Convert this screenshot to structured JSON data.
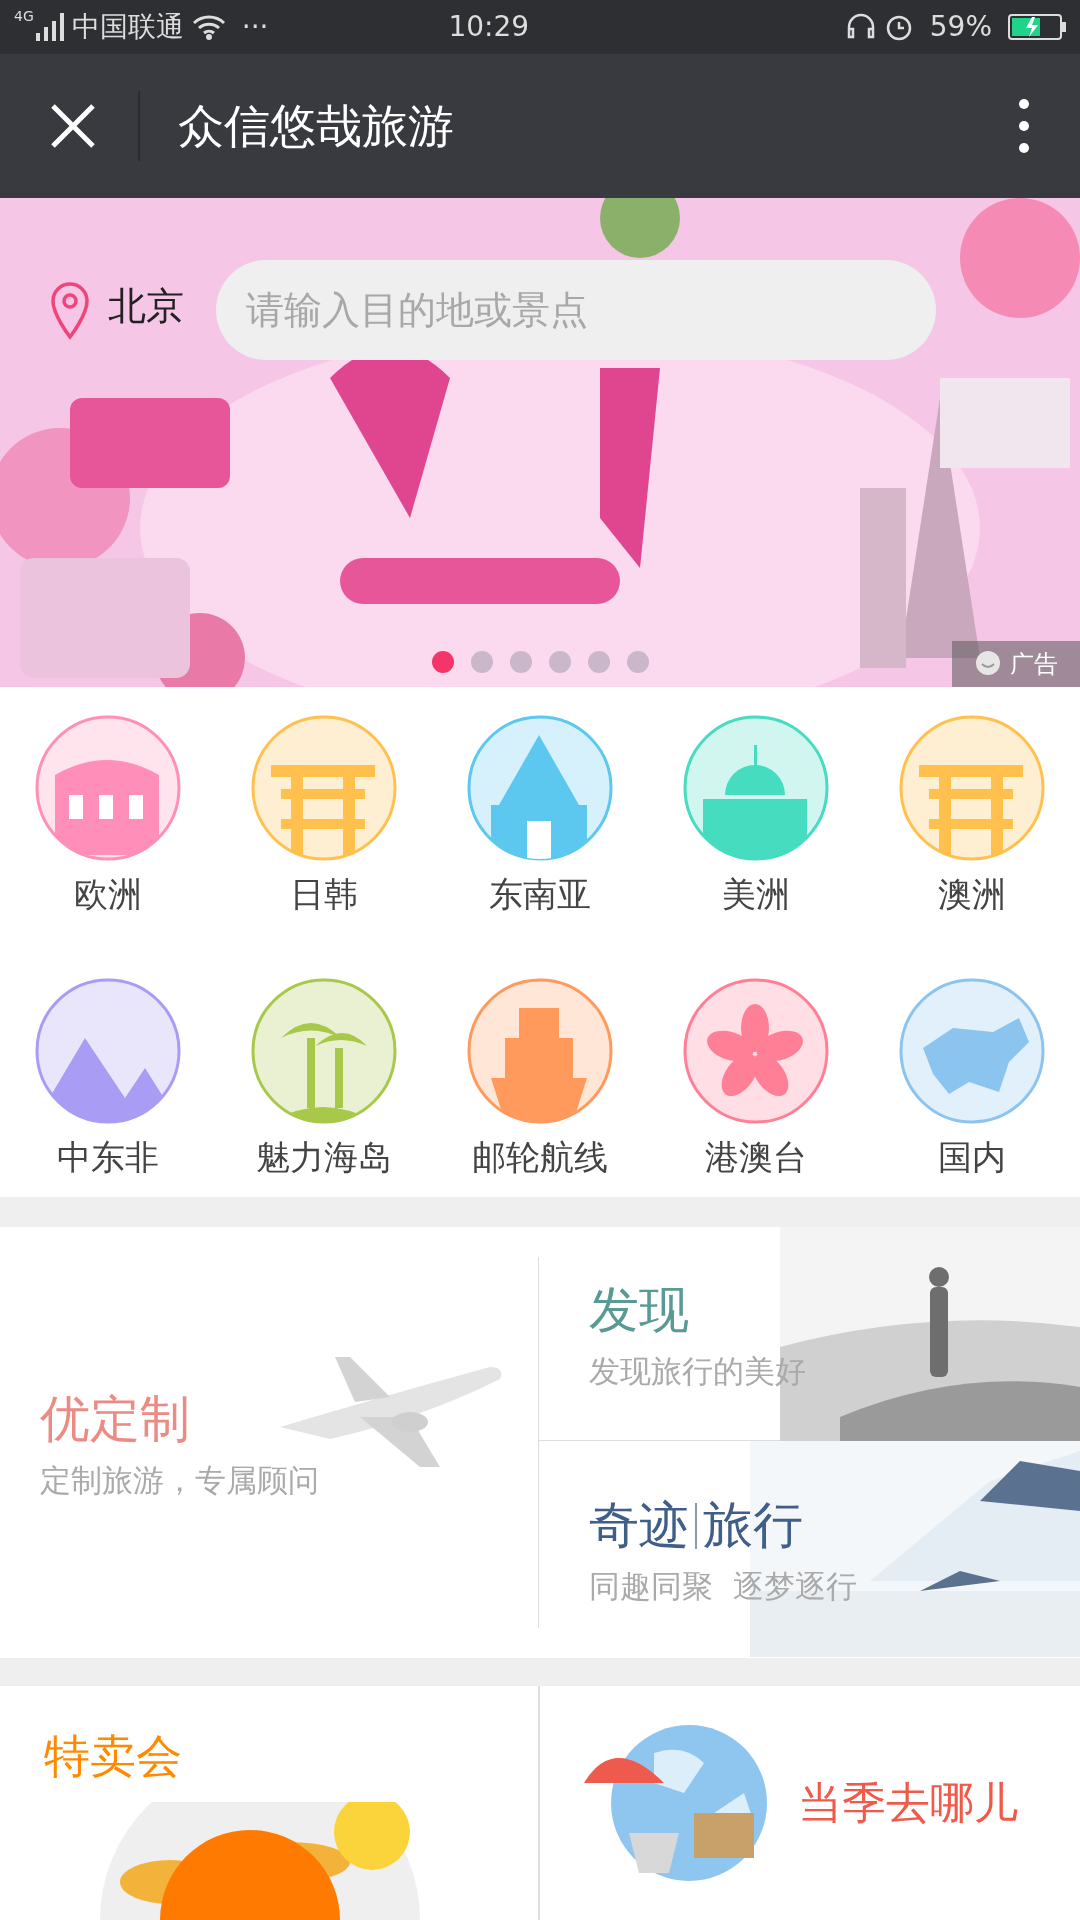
{
  "status_bar": {
    "network": "4G",
    "carrier": "中国联通",
    "dots": "···",
    "time": "10:29",
    "battery": "59%"
  },
  "app_bar": {
    "title": "众信悠哉旅游"
  },
  "banner": {
    "location": "北京",
    "search": {
      "placeholder": "请输入目的地或景点"
    },
    "ad_label": "广告",
    "pages": [
      {
        "selected": true
      },
      {
        "selected": false
      },
      {
        "selected": false
      },
      {
        "selected": false
      },
      {
        "selected": false
      },
      {
        "selected": false
      }
    ]
  },
  "categories": [
    {
      "label": "欧洲",
      "kind": "colosseum",
      "color": "#ff8fb8"
    },
    {
      "label": "日韩",
      "kind": "gate",
      "color": "#ffc04d"
    },
    {
      "label": "东南亚",
      "kind": "temple",
      "color": "#5cc8f0"
    },
    {
      "label": "美洲",
      "kind": "capitol",
      "color": "#45dcc0"
    },
    {
      "label": "澳洲",
      "kind": "gate",
      "color": "#ffc04d"
    },
    {
      "label": "中东非",
      "kind": "pyramid",
      "color": "#a99cf5"
    },
    {
      "label": "魅力海岛",
      "kind": "palm",
      "color": "#a8c84a"
    },
    {
      "label": "邮轮航线",
      "kind": "ship",
      "color": "#ff9a5c"
    },
    {
      "label": "港澳台",
      "kind": "flower",
      "color": "#ff7f96"
    },
    {
      "label": "国内",
      "kind": "map",
      "color": "#8cc4f0"
    }
  ],
  "promos": {
    "custom": {
      "title": "优定制",
      "subtitle": "定制旅游，专属顾问"
    },
    "discover": {
      "title": "发现",
      "subtitle": "发现旅行的美好"
    },
    "miracle": {
      "title_a": "奇迹",
      "title_b": "旅行",
      "subtitle": "同趣同聚  逐梦逐行"
    }
  },
  "features": {
    "sale": "特卖会",
    "season": "当季去哪儿"
  }
}
